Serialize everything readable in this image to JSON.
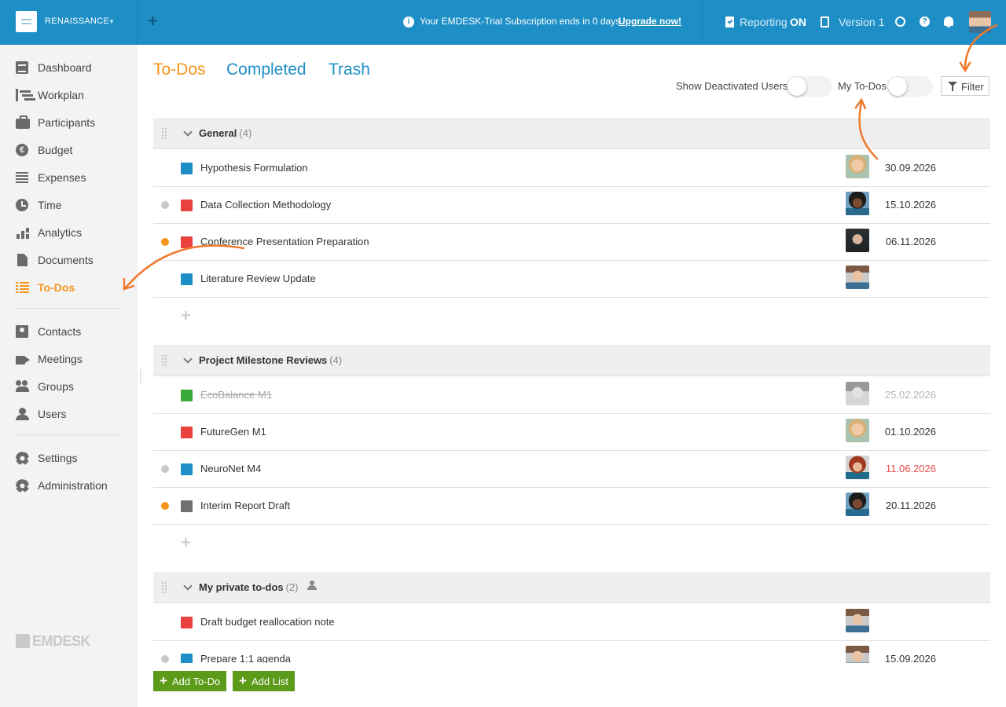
{
  "topbar": {
    "project_name": "RENAISSANCE",
    "trial_message": "Your EMDESK-Trial Subscription ends in 0 days.",
    "trial_link": "Upgrade now!",
    "reporting_label": "Reporting",
    "reporting_state": "ON",
    "version_label": "Version 1",
    "accent_color": "#1e8fc6"
  },
  "sidebar": {
    "items": [
      {
        "label": "Dashboard",
        "icon": "dashboard-icon"
      },
      {
        "label": "Workplan",
        "icon": "workplan-icon"
      },
      {
        "label": "Participants",
        "icon": "briefcase-icon"
      },
      {
        "label": "Budget",
        "icon": "euro-icon"
      },
      {
        "label": "Expenses",
        "icon": "expenses-icon"
      },
      {
        "label": "Time",
        "icon": "clock-icon"
      },
      {
        "label": "Analytics",
        "icon": "bar-chart-icon"
      },
      {
        "label": "Documents",
        "icon": "document-icon"
      },
      {
        "label": "To-Dos",
        "icon": "list-icon",
        "active": true
      },
      {
        "label": "Contacts",
        "icon": "contact-card-icon"
      },
      {
        "label": "Meetings",
        "icon": "video-camera-icon"
      },
      {
        "label": "Groups",
        "icon": "group-icon"
      },
      {
        "label": "Users",
        "icon": "user-icon"
      },
      {
        "label": "Settings",
        "icon": "gear-icon"
      },
      {
        "label": "Administration",
        "icon": "gear-icon"
      }
    ],
    "brand": "EMDESK"
  },
  "tabs": [
    {
      "label": "To-Dos",
      "active": true
    },
    {
      "label": "Completed"
    },
    {
      "label": "Trash"
    }
  ],
  "filters": {
    "show_deactivated_label": "Show Deactivated Users",
    "my_todos_label": "My To-Dos",
    "filter_label": "Filter"
  },
  "lists": [
    {
      "title": "General",
      "count": "(4)",
      "items": [
        {
          "title": "Hypothesis Formulation",
          "category_color": "#1e8fc6",
          "status": "",
          "avatar": "blonde-woman",
          "date": "30.09.2026"
        },
        {
          "title": "Data Collection Methodology",
          "category_color": "#e8413e",
          "status": "grey",
          "avatar": "curly-woman",
          "date": "15.10.2026"
        },
        {
          "title": "Conference Presentation Preparation",
          "category_color": "#e8413e",
          "status": "orange",
          "avatar": "dark-man",
          "date": "06.11.2026"
        },
        {
          "title": "Literature Review Update",
          "category_color": "#1e8fc6",
          "status": "",
          "avatar": "bearded-man",
          "date": ""
        }
      ]
    },
    {
      "title": "Project Milestone Reviews",
      "count": "(4)",
      "items": [
        {
          "title": "EcoBalance M1",
          "category_color": "#3aa838",
          "status": "",
          "avatar": "grey-woman",
          "date": "25.02.2026",
          "completed": true
        },
        {
          "title": "FutureGen M1",
          "category_color": "#e8413e",
          "status": "",
          "avatar": "blonde-woman",
          "date": "01.10.2026"
        },
        {
          "title": "NeuroNet M4",
          "category_color": "#1e8fc6",
          "status": "grey",
          "avatar": "red-haired-woman",
          "date": "11.06.2026",
          "overdue": true
        },
        {
          "title": "Interim Report Draft",
          "category_color": "#707070",
          "status": "orange",
          "avatar": "curly-woman",
          "date": "20.11.2026"
        }
      ]
    },
    {
      "title": "My private to-dos",
      "count": "(2)",
      "private": true,
      "items": [
        {
          "title": "Draft budget reallocation note",
          "category_color": "#e8413e",
          "status": "",
          "avatar": "bearded-man",
          "date": ""
        },
        {
          "title": "Prepare 1:1 agenda",
          "category_color": "#1e8fc6",
          "status": "grey",
          "avatar": "bearded-man",
          "date": "15.09.2026"
        }
      ]
    }
  ],
  "buttons": {
    "add_todo": "Add To-Do",
    "add_list": "Add List"
  },
  "colors": {
    "active_orange": "#f7941d",
    "status_grey": "#c8c8c8",
    "status_orange": "#f7941d",
    "overdue_red": "#e84c4c",
    "button_green": "#5c9a1a"
  }
}
